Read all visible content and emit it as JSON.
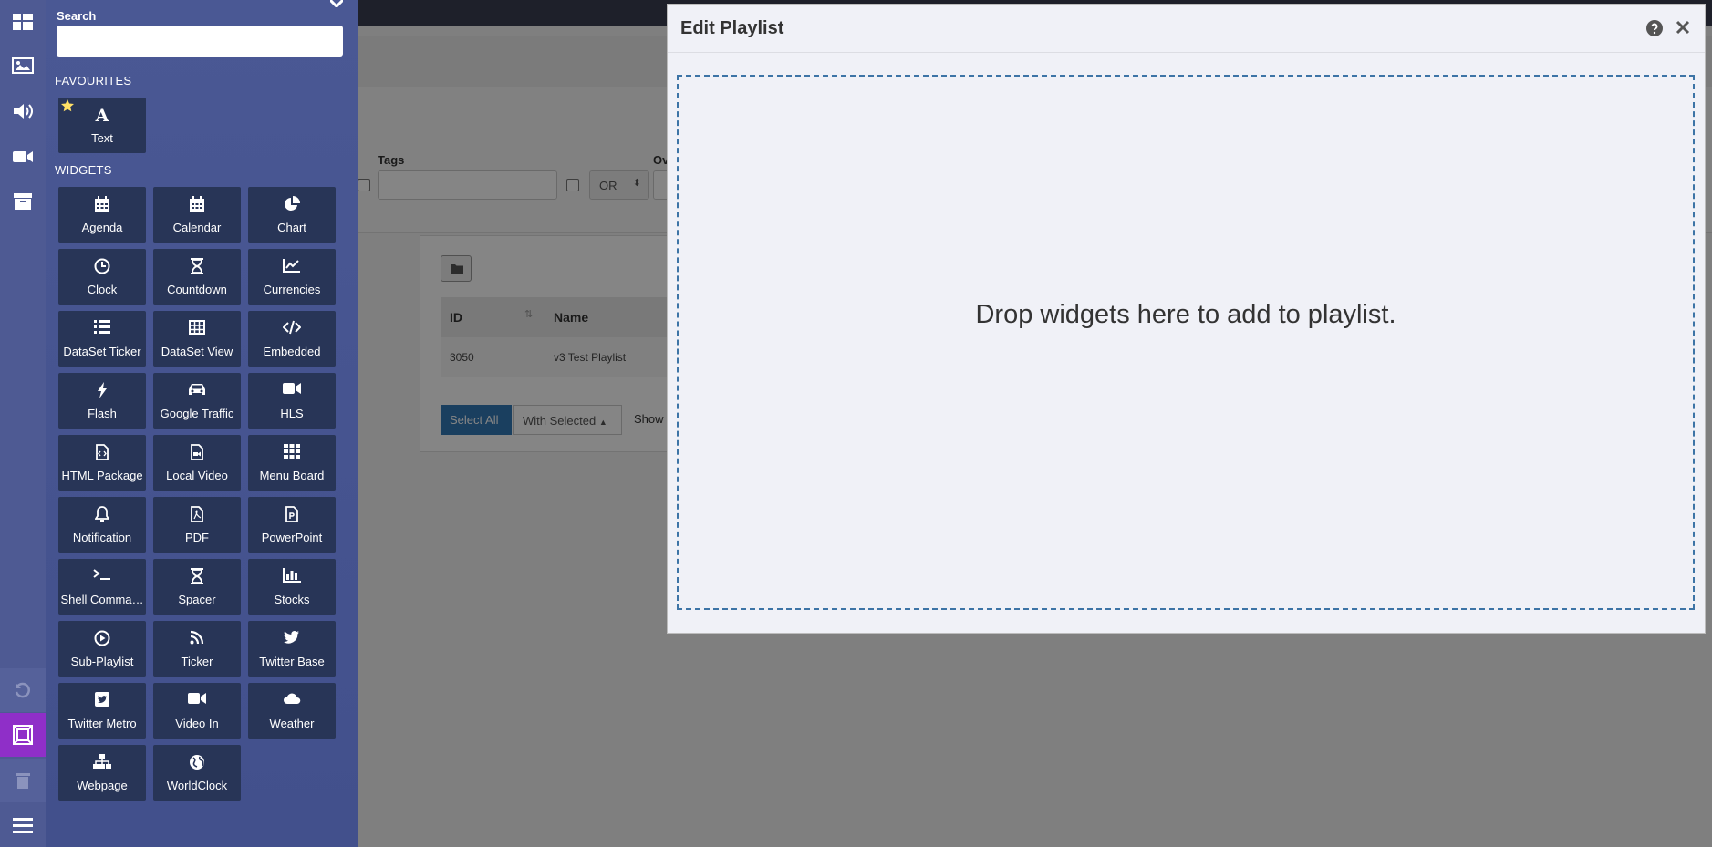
{
  "background": {
    "filters": {
      "tags_label": "Tags",
      "owner_label": "Ov",
      "logic_select": "OR"
    },
    "table": {
      "headers": [
        "ID",
        "Name"
      ],
      "rows": [
        {
          "id": "3050",
          "name": "v3 Test Playlist"
        }
      ]
    },
    "buttons": {
      "select_all": "Select All",
      "with_selected": "With Selected",
      "show": "Show"
    }
  },
  "toolbox": {
    "search_label": "Search",
    "search_placeholder": "",
    "favourites_title": "FAVOURITES",
    "favourites": [
      {
        "label": "Text",
        "icon": "text-icon",
        "starred": true
      }
    ],
    "widgets_title": "WIDGETS",
    "widgets": [
      {
        "label": "Agenda",
        "icon": "calendar-icon"
      },
      {
        "label": "Calendar",
        "icon": "calendar-icon"
      },
      {
        "label": "Chart",
        "icon": "pie-chart-icon"
      },
      {
        "label": "Clock",
        "icon": "clock-icon"
      },
      {
        "label": "Countdown",
        "icon": "hourglass-icon"
      },
      {
        "label": "Currencies",
        "icon": "line-chart-icon"
      },
      {
        "label": "DataSet Ticker",
        "icon": "list-icon"
      },
      {
        "label": "DataSet View",
        "icon": "table-icon"
      },
      {
        "label": "Embedded",
        "icon": "code-icon"
      },
      {
        "label": "Flash",
        "icon": "bolt-icon"
      },
      {
        "label": "Google Traffic",
        "icon": "car-icon"
      },
      {
        "label": "HLS",
        "icon": "video-camera-icon"
      },
      {
        "label": "HTML Package",
        "icon": "file-code-icon"
      },
      {
        "label": "Local Video",
        "icon": "file-video-icon"
      },
      {
        "label": "Menu Board",
        "icon": "grid-icon"
      },
      {
        "label": "Notification",
        "icon": "bell-icon"
      },
      {
        "label": "PDF",
        "icon": "file-pdf-icon"
      },
      {
        "label": "PowerPoint",
        "icon": "file-powerpoint-icon"
      },
      {
        "label": "Shell Comma…",
        "icon": "terminal-icon"
      },
      {
        "label": "Spacer",
        "icon": "hourglass-icon"
      },
      {
        "label": "Stocks",
        "icon": "bar-chart-icon"
      },
      {
        "label": "Sub-Playlist",
        "icon": "play-circle-icon"
      },
      {
        "label": "Ticker",
        "icon": "rss-icon"
      },
      {
        "label": "Twitter Base",
        "icon": "twitter-icon"
      },
      {
        "label": "Twitter Metro",
        "icon": "twitter-square-icon"
      },
      {
        "label": "Video In",
        "icon": "video-camera-icon"
      },
      {
        "label": "Weather",
        "icon": "cloud-icon"
      },
      {
        "label": "Webpage",
        "icon": "sitemap-icon"
      },
      {
        "label": "WorldClock",
        "icon": "globe-icon"
      }
    ]
  },
  "rail": [
    "layout-icon",
    "image-icon",
    "audio-icon",
    "video-icon",
    "archive-icon",
    "undo-icon",
    "region-icon",
    "trash-icon",
    "menu-icon"
  ],
  "modal": {
    "title": "Edit Playlist",
    "drop_text": "Drop widgets here to add to playlist."
  },
  "colors": {
    "rail": "#4e5a93",
    "toolbox": "#4a5894",
    "tile": "#283557",
    "active_rail": "#8f2fc8",
    "dropzone_border": "#3d74a6",
    "modal_bg": "#f0f1f7"
  }
}
